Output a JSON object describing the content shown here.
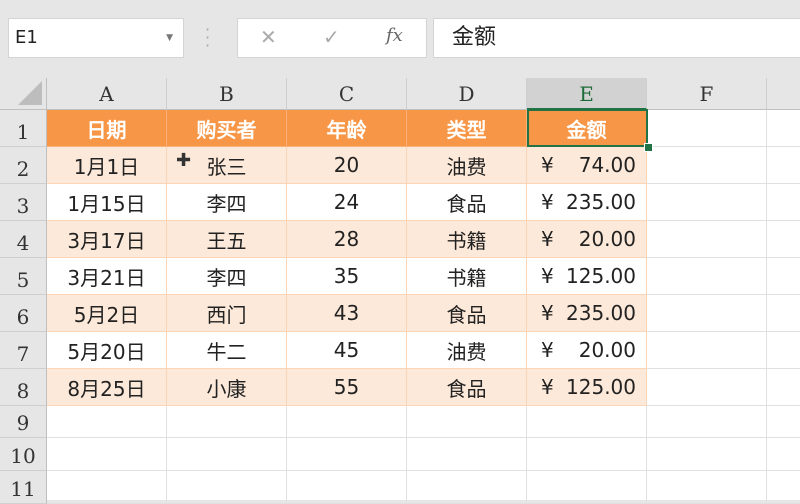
{
  "name_box": "E1",
  "formula_buttons": {
    "cancel": "✕",
    "enter": "✓",
    "fx": "fx"
  },
  "formula_value": "金额",
  "columns": [
    "A",
    "B",
    "C",
    "D",
    "E",
    "F"
  ],
  "rows": [
    "1",
    "2",
    "3",
    "4",
    "5",
    "6",
    "7",
    "8",
    "9",
    "10",
    "11"
  ],
  "header": [
    "日期",
    "购买者",
    "年龄",
    "类型",
    "金额"
  ],
  "data": [
    [
      "1月1日",
      "张三",
      "20",
      "油费",
      "¥",
      "74.00"
    ],
    [
      "1月15日",
      "李四",
      "24",
      "食品",
      "¥",
      "235.00"
    ],
    [
      "3月17日",
      "王五",
      "28",
      "书籍",
      "¥",
      "20.00"
    ],
    [
      "3月21日",
      "李四",
      "35",
      "书籍",
      "¥",
      "125.00"
    ],
    [
      "5月2日",
      "西门",
      "43",
      "食品",
      "¥",
      "235.00"
    ],
    [
      "5月20日",
      "牛二",
      "45",
      "油费",
      "¥",
      "20.00"
    ],
    [
      "8月25日",
      "小康",
      "55",
      "食品",
      "¥",
      "125.00"
    ]
  ],
  "colors": {
    "header": "#F79646",
    "band": "#FDE9D9",
    "selection": "#217346"
  }
}
